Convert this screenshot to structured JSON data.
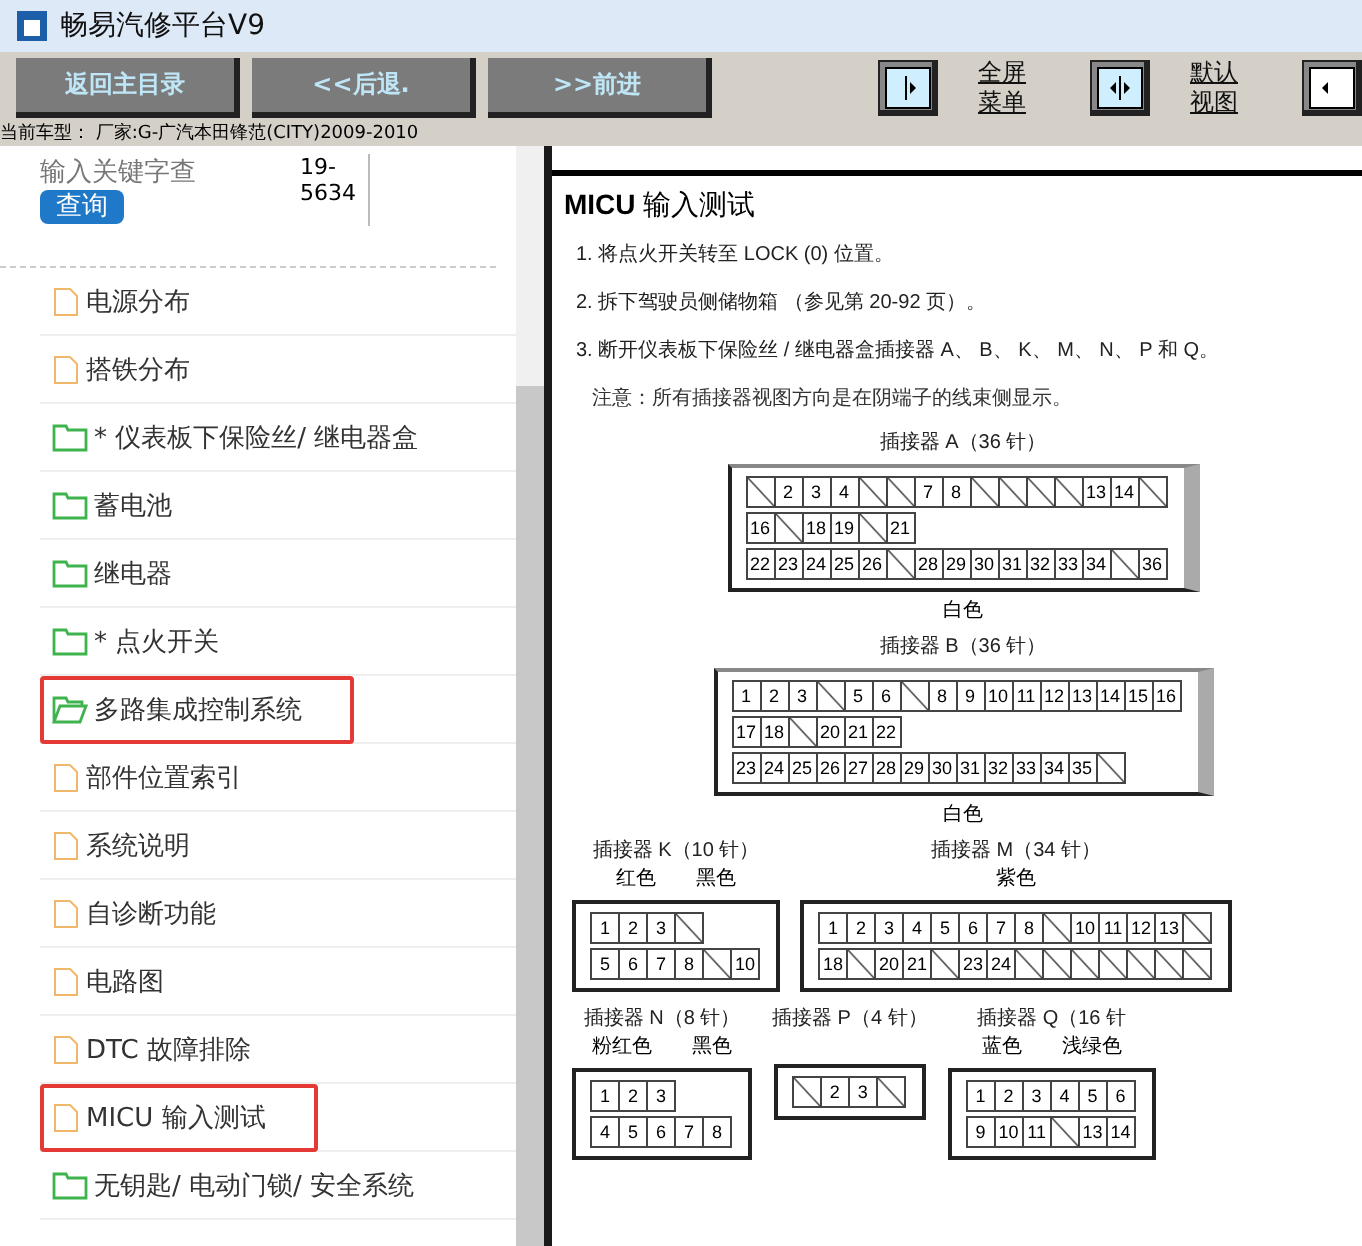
{
  "window": {
    "title": "畅易汽修平台V9"
  },
  "toolbar": {
    "nav_buttons": [
      "返回主目录",
      "<<后退.",
      ">>前进"
    ],
    "view_buttons": [
      {
        "kind": "right",
        "label": [
          "全屏",
          "菜单"
        ]
      },
      {
        "kind": "both",
        "label": [
          "默认",
          "视图"
        ]
      },
      {
        "kind": "left"
      }
    ]
  },
  "car_info": "当前车型： 厂家:G-广汽本田锋范(CITY)2009-2010",
  "search": {
    "placeholder": "输入关键字查",
    "button": "查询",
    "result": "19-5634"
  },
  "tree": [
    {
      "label": "电源分布",
      "kind": "file",
      "highlighted": false
    },
    {
      "label": "搭铁分布",
      "kind": "file",
      "highlighted": false,
      "children": [
        {
          "label": "* 仪表板下保险丝/ 继电器盒",
          "kind": "folder",
          "highlighted": false,
          "expanded": false
        },
        {
          "label": "蓄电池",
          "kind": "folder",
          "highlighted": false,
          "expanded": false
        },
        {
          "label": "继电器",
          "kind": "folder",
          "highlighted": false,
          "expanded": false
        },
        {
          "label": "* 点火开关",
          "kind": "folder",
          "highlighted": false,
          "expanded": false
        },
        {
          "label": "多路集成控制系统",
          "kind": "folder",
          "highlighted": true,
          "expanded": true,
          "children": [
            {
              "label": "部件位置索引",
              "kind": "file",
              "highlighted": false
            },
            {
              "label": "系统说明",
              "kind": "file",
              "highlighted": false
            },
            {
              "label": "自诊断功能",
              "kind": "file",
              "highlighted": false
            },
            {
              "label": "电路图",
              "kind": "file",
              "highlighted": false
            },
            {
              "label": "DTC 故障排除",
              "kind": "file",
              "highlighted": false
            },
            {
              "label": "MICU 输入测试",
              "kind": "file",
              "highlighted": true
            }
          ]
        },
        {
          "label": "无钥匙/ 电动门锁/ 安全系统",
          "kind": "folder",
          "highlighted": false,
          "expanded": false
        }
      ]
    }
  ],
  "document": {
    "title": "**MICU** 输入测试",
    "steps": [
      "1. 将点火开关转至 LOCK (0) 位置。",
      "2. 拆下驾驶员侧储物箱 （参见第 20-92 页）。",
      "3. 断开仪表板下保险丝 / 继电器盒插接器 A、 B、 K、 M、 N、 P 和 Q。"
    ],
    "note": "注意：所有插接器视图方向是在阴端子的线束侧显示。",
    "connectors_large": [
      {
        "title": "插接器 A（36 针）",
        "rows": [
          [
            null,
            "2",
            "3",
            "4",
            null,
            null,
            "7",
            "8",
            null,
            null,
            null,
            null,
            "13",
            "14",
            null
          ],
          [
            "16",
            null,
            "18",
            "19",
            null,
            "21"
          ],
          [
            "22",
            "23",
            "24",
            "25",
            "26",
            null,
            "28",
            "29",
            "30",
            "31",
            "32",
            "33",
            "34",
            null,
            "36"
          ]
        ],
        "wire_colors": [
          "白色"
        ]
      },
      {
        "title": "插接器 B（36 针）",
        "rows": [
          [
            "1",
            "2",
            "3",
            null,
            "5",
            "6",
            null,
            "8",
            "9",
            "10",
            "11",
            "12",
            "13",
            "14",
            "15",
            "16"
          ],
          [
            "17",
            "18",
            null,
            "20",
            "21",
            "22"
          ],
          [
            "23",
            "24",
            "25",
            "26",
            "27",
            "28",
            "29",
            "30",
            "31",
            "32",
            "33",
            "34",
            "35",
            null
          ]
        ],
        "wire_colors": [
          "白色"
        ]
      }
    ],
    "connectors_small": [
      {
        "title": "插接器 K（10 针）",
        "rows": [
          [
            "1",
            "2",
            "3",
            null
          ],
          [
            "5",
            "6",
            "7",
            "8",
            null,
            "10"
          ]
        ],
        "wire_colors": [
          "红色",
          "黑色"
        ]
      },
      {
        "title": "插接器 M（34 针）",
        "rows": [
          [
            "1",
            "2",
            "3",
            "4",
            "5",
            "6",
            "7",
            "8",
            null,
            "10",
            "11",
            "12",
            "13",
            null
          ],
          [
            "18",
            null,
            "20",
            "21",
            null,
            "23",
            "24",
            null,
            null,
            null,
            null,
            null,
            null,
            null
          ]
        ],
        "wire_colors": [
          "紫色"
        ]
      },
      {
        "title": "插接器 N（8 针）",
        "rows": [
          [
            "1",
            "2",
            "3"
          ],
          [
            "4",
            "5",
            "6",
            "7",
            "8"
          ]
        ],
        "wire_colors": [
          "粉红色",
          "黑色"
        ]
      },
      {
        "title": "插接器 P（4 针）",
        "rows": [
          [
            null,
            "2",
            "3",
            null
          ]
        ]
      },
      {
        "title": "插接器 Q（16 针",
        "rows": [
          [
            "1",
            "2",
            "3",
            "4",
            "5",
            "6"
          ],
          [
            "9",
            "10",
            "11",
            null,
            "13",
            "14"
          ]
        ],
        "wire_colors": [
          "蓝色",
          "浅绿色"
        ]
      }
    ]
  }
}
